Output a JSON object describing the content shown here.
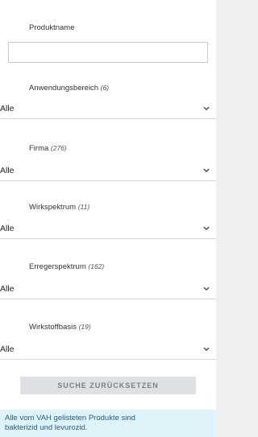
{
  "fields": {
    "product_name": {
      "label": "Produktname",
      "value": "",
      "placeholder": ""
    },
    "filters": [
      {
        "label": "Anwendungsbereich",
        "count": "(6)",
        "value": "Alle"
      },
      {
        "label": "Firma",
        "count": "(276)",
        "value": "Alle"
      },
      {
        "label": "Wirkspektrum",
        "count": "(11)",
        "value": "Alle"
      },
      {
        "label": "Erregerspektrum",
        "count": "(162)",
        "value": "Alle"
      },
      {
        "label": "Wirkstoffbasis",
        "count": "(19)",
        "value": "Alle"
      }
    ]
  },
  "reset_button_label": "SUCHE ZURÜCKSETZEN",
  "notice": {
    "line1": "Alle vom VAH gelisteten Produkte sind",
    "line2": "bakterizid und levurozid."
  },
  "icons": {
    "select_arrow": "chevron-down-icon"
  },
  "colors": {
    "notice_background": "#dff3fb",
    "notice_text": "#2a5d7a",
    "button_background": "#dee0e3",
    "button_text": "#7b7e83"
  }
}
